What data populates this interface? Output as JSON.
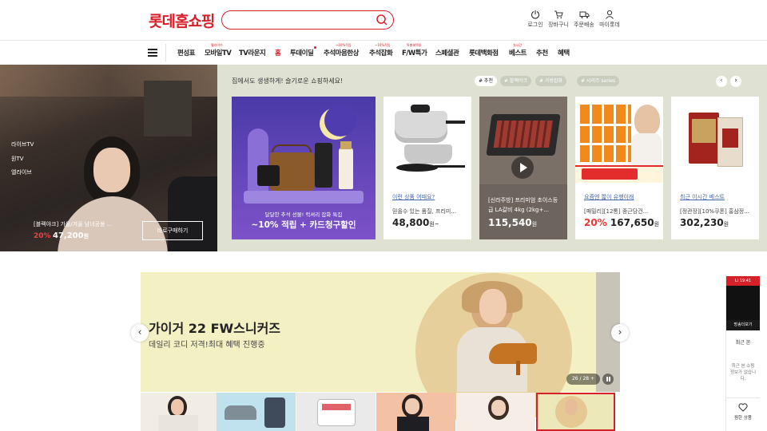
{
  "header": {
    "logo": "롯데홈쇼핑",
    "search_placeholder": "",
    "icons": [
      {
        "name": "power-icon",
        "label": "로그인"
      },
      {
        "name": "cart-icon",
        "label": "장바구니"
      },
      {
        "name": "delivery-icon",
        "label": "주문배송"
      },
      {
        "name": "user-icon",
        "label": "마이롯데"
      }
    ]
  },
  "nav": {
    "items": [
      {
        "label": "편성표",
        "sup": ""
      },
      {
        "label": "모바일TV",
        "sup": "웰라이브"
      },
      {
        "label": "TV라운지",
        "sup": ""
      },
      {
        "label": "홈",
        "sup": ""
      },
      {
        "label": "투데이딜",
        "sup": ""
      },
      {
        "label": "추석마음한상",
        "sup": "~10%적립"
      },
      {
        "label": "추석잡화",
        "sup": "~10%적립"
      },
      {
        "label": "F/W특가",
        "sup": "특별혜택들"
      },
      {
        "label": "스페셜관",
        "sup": ""
      },
      {
        "label": "롯데백화점",
        "sup": ""
      },
      {
        "label": "베스트",
        "sup": "실시간"
      },
      {
        "label": "추천",
        "sup": ""
      },
      {
        "label": "혜택",
        "sup": ""
      }
    ],
    "active": "홈"
  },
  "live": {
    "labels": [
      "라이브TV",
      "원TV",
      "엘라이브"
    ],
    "title": "[블랙야크] 가을/겨울 남녀공용 ...",
    "discount": "20%",
    "price": "47,200",
    "won": "원",
    "buy_button": "바로구매하기"
  },
  "recommend": {
    "title": "집에서도 생생하게! 슬기로운 쇼핑하세요!",
    "chips": [
      "# 추천",
      "# 블랙야크",
      "# 가방잡화",
      "# 시리즈 series"
    ],
    "prev": "‹",
    "next": "›",
    "promo": {
      "line1": "달달한 추석 선물! 럭셔리 잡화 특집",
      "line2": "~10% 적립 + 카드청구할인"
    },
    "cards": [
      {
        "tag": "이런 상품 어때요?",
        "desc": "믿을수 있는 품질, 프리미...",
        "discount": "",
        "price": "48,800",
        "unit": "원~"
      },
      {
        "tag": "",
        "desc": "[신라주방] 프리미엄 초이스등급 LA갈비 4kg (2kg+...",
        "discount": "",
        "price": "115,540",
        "unit": "원"
      },
      {
        "tag": "요즘엔 짧이 유행이래",
        "desc": "[패밀리][12통] 종근당건...",
        "discount": "20%",
        "price": "167,650",
        "unit": "원"
      },
      {
        "tag": "최근 이시간 베스트",
        "desc": "[정관장][10%쿠폰] 홍삼정...",
        "discount": "",
        "price": "302,230",
        "unit": "원"
      }
    ]
  },
  "banner": {
    "title": "가이거 22 FW스니커즈",
    "subtitle": "데일리 코디 저격!최대 혜택 진행중",
    "counter": "26 / 28",
    "plus": "+",
    "prev": "‹",
    "next": "›"
  },
  "rail": {
    "live_tag": "LI 19:41",
    "live_button": "방송더보기",
    "recent_title": "최근 본",
    "recent_empty": "최근 본 쇼핑 정보가 없습니다.",
    "like_label": "찜한 상품"
  },
  "colors": {
    "brand": "#d6202a",
    "rec_bg": "#dfe2d3",
    "banner_bg": "#f3f0c4"
  }
}
